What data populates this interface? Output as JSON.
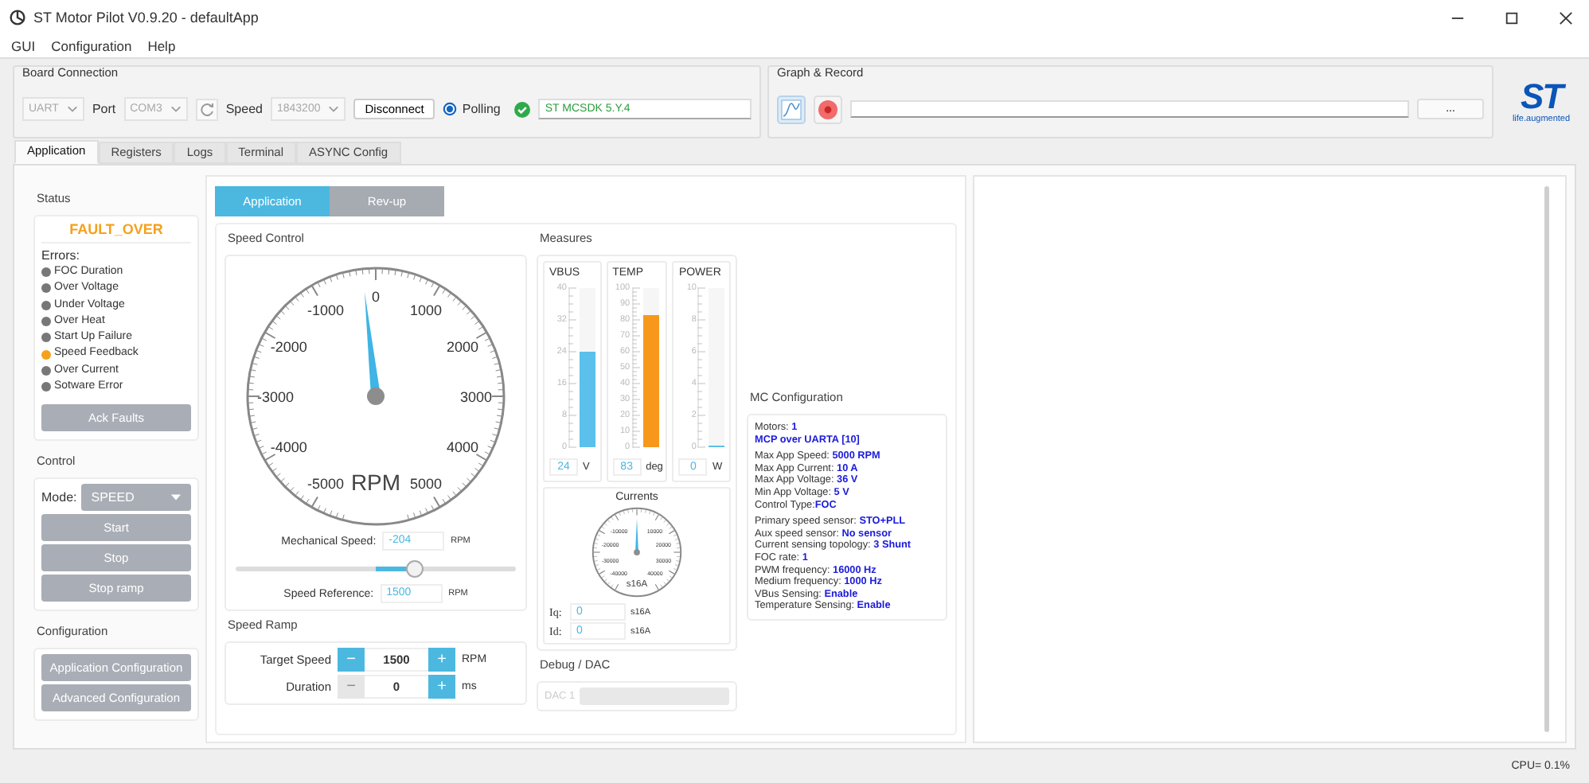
{
  "window": {
    "title": "ST Motor Pilot V0.9.20 - defaultApp"
  },
  "menu": [
    "GUI",
    "Configuration",
    "Help"
  ],
  "board_connection": {
    "title": "Board Connection",
    "interface": {
      "value": "UART",
      "disabled": true
    },
    "port_label": "Port",
    "port": {
      "value": "COM3",
      "disabled": true
    },
    "speed_label": "Speed",
    "speed": {
      "value": "1843200",
      "disabled": true
    },
    "disconnect_button": "Disconnect",
    "polling": {
      "label": "Polling",
      "selected": true
    },
    "firmware": "ST MCSDK 5.Y.4"
  },
  "graph_record": {
    "title": "Graph & Record",
    "browse_button": "..."
  },
  "logo": {
    "wordmark": "ST",
    "tagline": "life.augmented"
  },
  "tabs": [
    {
      "label": "Application",
      "selected": true
    },
    {
      "label": "Registers",
      "selected": false
    },
    {
      "label": "Logs",
      "selected": false
    },
    {
      "label": "Terminal",
      "selected": false
    },
    {
      "label": "ASYNC Config",
      "selected": false
    }
  ],
  "status": {
    "title": "Status",
    "state": "FAULT_OVER",
    "errors_label": "Errors:",
    "errors": [
      {
        "name": "FOC Duration",
        "active": false
      },
      {
        "name": "Over Voltage",
        "active": false
      },
      {
        "name": "Under Voltage",
        "active": false
      },
      {
        "name": "Over Heat",
        "active": false
      },
      {
        "name": "Start Up Failure",
        "active": false
      },
      {
        "name": "Speed Feedback",
        "active": true
      },
      {
        "name": "Over Current",
        "active": false
      },
      {
        "name": "Sotware Error",
        "active": false
      }
    ],
    "ack_button": "Ack Faults"
  },
  "control": {
    "title": "Control",
    "mode_label": "Mode:",
    "mode": "SPEED",
    "buttons": [
      "Start",
      "Stop",
      "Stop ramp"
    ]
  },
  "configuration": {
    "title": "Configuration",
    "buttons": [
      "Application Configuration",
      "Advanced Configuration"
    ]
  },
  "subtabs": [
    {
      "label": "Application",
      "selected": true
    },
    {
      "label": "Rev-up",
      "selected": false
    }
  ],
  "speed_control": {
    "title": "Speed Control",
    "gauge": {
      "labels": [
        "-5000",
        "-4000",
        "-3000",
        "-2000",
        "-1000",
        "0",
        "1000",
        "2000",
        "3000",
        "4000",
        "5000"
      ],
      "unit": "RPM",
      "level": 0.483
    },
    "mechanical_speed": {
      "label": "Mechanical Speed:",
      "value": "-204",
      "unit": "RPM"
    },
    "slider": {
      "level": 0.64
    },
    "speed_reference": {
      "label": "Speed Reference:",
      "value": "1500",
      "unit": "RPM"
    }
  },
  "speed_ramp": {
    "title": "Speed Ramp",
    "rows": [
      {
        "label": "Target Speed",
        "decrement": "−",
        "value": "1500",
        "increment": "+",
        "unit": "RPM",
        "decrement_disabled": false
      },
      {
        "label": "Duration",
        "decrement": "−",
        "value": "0",
        "increment": "+",
        "unit": "ms",
        "decrement_disabled": true
      }
    ]
  },
  "measures": {
    "title": "Measures",
    "meters": [
      {
        "name": "VBUS",
        "scale": [
          "40",
          "32",
          "24",
          "16",
          "8",
          "0"
        ],
        "level": 0.6,
        "value": "24",
        "unit": "V",
        "color": "#5bc0eb"
      },
      {
        "name": "TEMP",
        "scale": [
          "100",
          "90",
          "80",
          "70",
          "60",
          "50",
          "40",
          "30",
          "20",
          "10",
          "0"
        ],
        "level": 0.83,
        "value": "83",
        "unit": "deg",
        "color": "#f7981d"
      },
      {
        "name": "POWER",
        "scale": [
          "10",
          "8",
          "6",
          "4",
          "2",
          "0"
        ],
        "level": 0,
        "value": "0",
        "unit": "W"
      }
    ],
    "currents": {
      "title": "Currents",
      "labels": [
        "-10000",
        "10000",
        "-20000",
        "20000",
        "-30000",
        "30000",
        "-40000",
        "40000"
      ],
      "unit": "s16A",
      "level": 0.5,
      "readings": [
        {
          "label": "Iq:",
          "value": "0",
          "unit": "s16A"
        },
        {
          "label": "Id:",
          "value": "0",
          "unit": "s16A"
        }
      ]
    }
  },
  "debug_dac": {
    "title": "Debug / DAC",
    "channel": "DAC 1"
  },
  "mc_configuration": {
    "title": "MC Configuration",
    "groups": [
      [
        {
          "text": "Motors: **1**",
          "strong": false
        },
        {
          "text": "MCP over UARTA [10]",
          "strong": true
        }
      ],
      [
        {
          "text": "Max App Speed: **5000 RPM**",
          "strong": false
        },
        {
          "text": "Max App Current: **10 A**",
          "strong": false
        },
        {
          "text": "Max App Voltage: **36 V**",
          "strong": false
        },
        {
          "text": "Min App Voltage: **5 V**",
          "strong": false
        },
        {
          "text": "Control Type:**FOC**",
          "strong": false
        }
      ],
      [
        {
          "text": "Primary speed sensor: **STO+PLL**",
          "strong": false
        },
        {
          "text": "Aux speed sensor: **No sensor**",
          "strong": false
        },
        {
          "text": "Current sensing topology: **3 Shunt**",
          "strong": false
        },
        {
          "text": "FOC rate: **1**",
          "strong": false
        },
        {
          "text": "PWM frequency: **16000 Hz**",
          "strong": false
        },
        {
          "text": "Medium frequency: **1000 Hz**",
          "strong": false
        },
        {
          "text": "VBus Sensing: **Enable**",
          "strong": false
        },
        {
          "text": "Temperature Sensing: **Enable**",
          "strong": false
        }
      ]
    ]
  },
  "status_bar": {
    "cpu": "CPU= 0.1%"
  }
}
